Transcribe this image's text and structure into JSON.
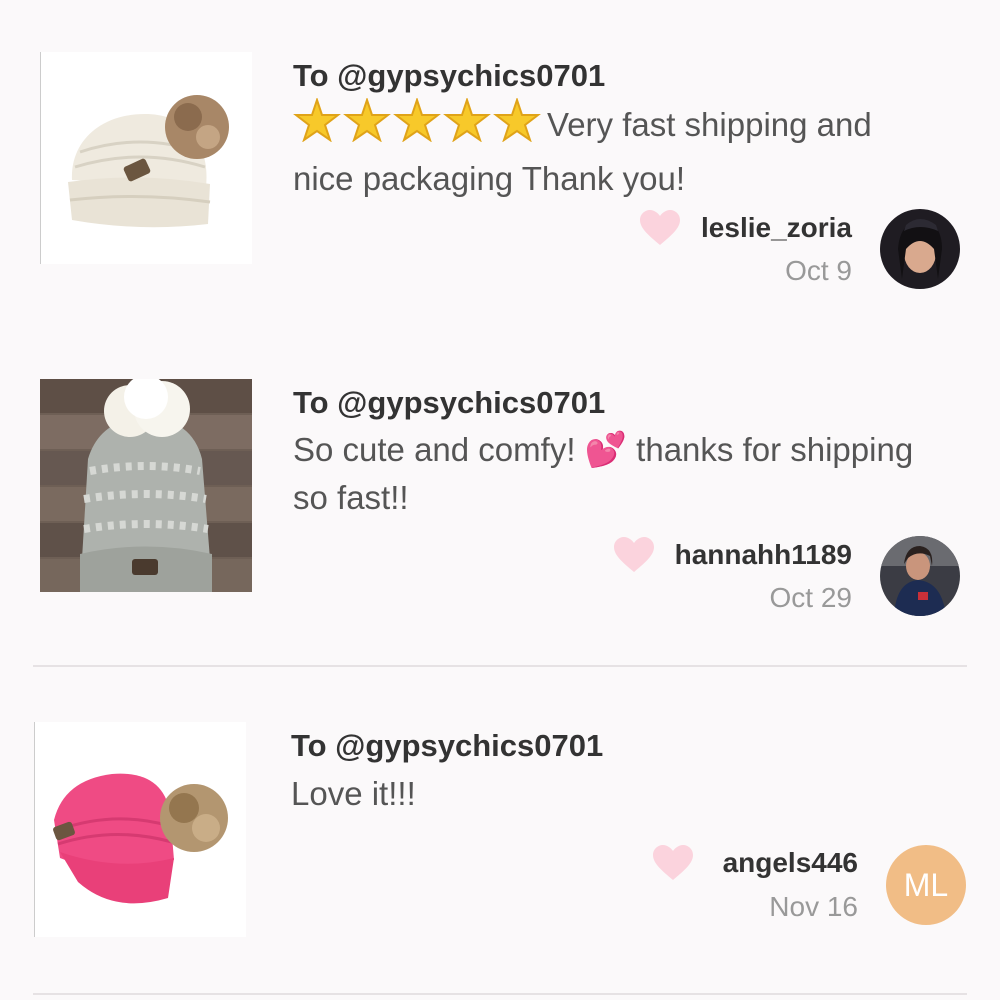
{
  "reviews": [
    {
      "to": "To @gypsychics0701",
      "rating_stars": 5,
      "text": "Very fast shipping and nice packaging Thank you!",
      "username": "leslie_zoria",
      "date": "Oct 9",
      "item_icon": "white-pompom-beanie"
    },
    {
      "to": "To @gypsychics0701",
      "text_a": "So cute and comfy!",
      "emoji": "💕",
      "text_b": "thanks for shipping so fast!!",
      "username": "hannahh1189",
      "date": "Oct 29",
      "item_icon": "gray-knit-beanie"
    },
    {
      "to": "To @gypsychics0701",
      "text": "Love it!!!",
      "username": "angels446",
      "date": "Nov 16",
      "avatar_initials": "ML",
      "avatar_color": "#f1bd86",
      "item_icon": "pink-pompom-beanie"
    }
  ],
  "colors": {
    "heart": "#fbd3dd",
    "background": "#fbf9fa",
    "star": "#f7c92a"
  }
}
